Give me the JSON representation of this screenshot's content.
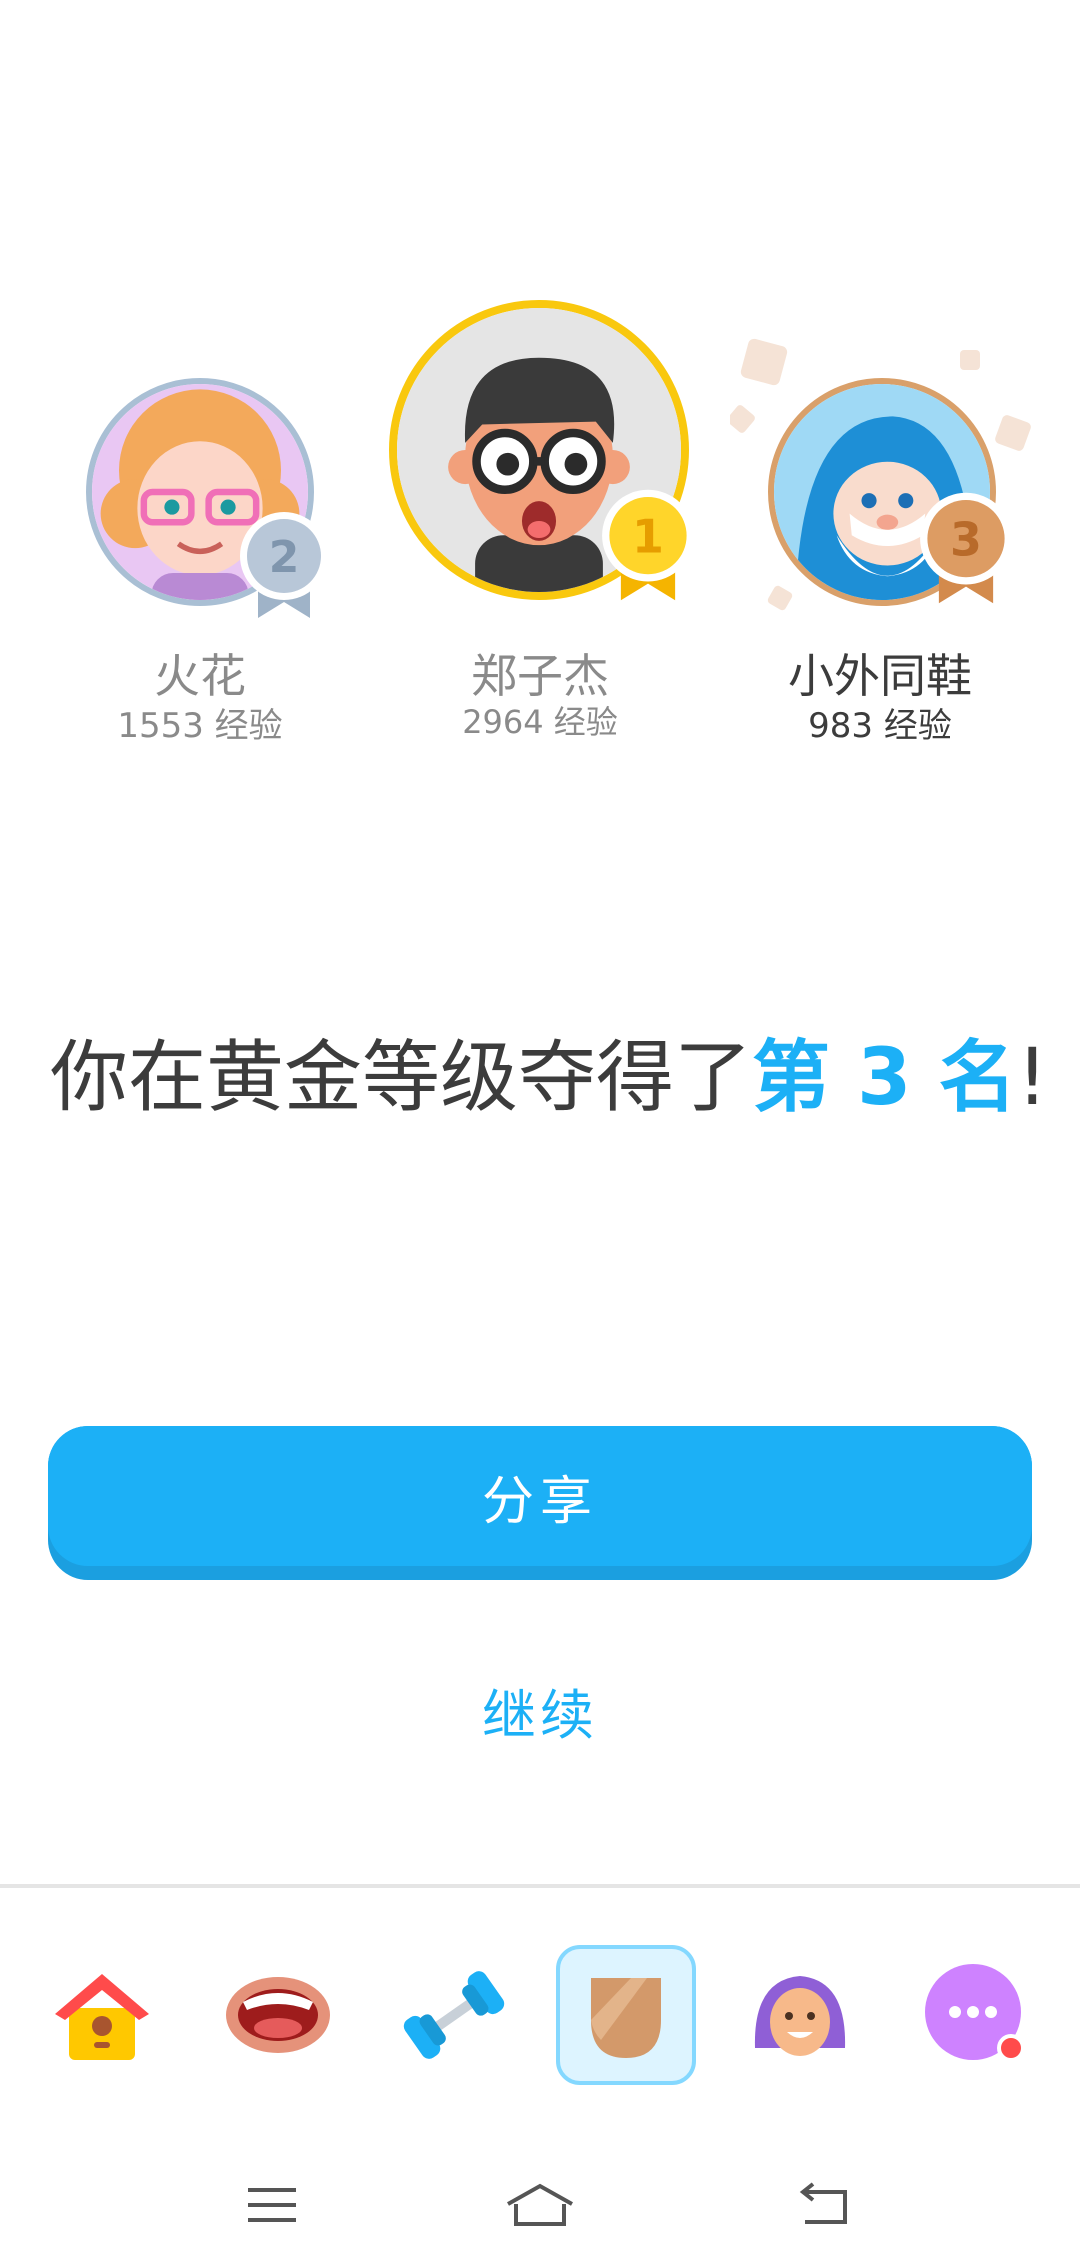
{
  "podium": [
    {
      "rank": "2",
      "name": "火花",
      "xp": "1553 经验",
      "ring_color": "#a9bfd4",
      "medal_color": "#b8c7d8",
      "medal_text_color": "#7f95ad",
      "name_color": "#8a8a8a"
    },
    {
      "rank": "1",
      "name": "郑子杰",
      "xp": "2964 经验",
      "ring_color": "#f9c80e",
      "medal_color": "#ffd52a",
      "medal_text_color": "#e69d00",
      "name_color": "#8a8a8a"
    },
    {
      "rank": "3",
      "name": "小外同鞋",
      "xp": "983 经验",
      "ring_color": "#d9a06a",
      "medal_color": "#dd9c63",
      "medal_text_color": "#b86a2a",
      "name_color": "#3c3c3c"
    }
  ],
  "headline": {
    "prefix": "你在黄金等级夺得了",
    "highlight": "第 3 名",
    "suffix": "!"
  },
  "actions": {
    "share_label": "分享",
    "continue_label": "继续"
  },
  "bottom_nav": [
    {
      "name": "home-tab",
      "icon": "home-icon",
      "active": false
    },
    {
      "name": "speak-tab",
      "icon": "mouth-icon",
      "active": false
    },
    {
      "name": "practice-tab",
      "icon": "dumbbell-icon",
      "active": false
    },
    {
      "name": "leagues-tab",
      "icon": "shield-icon",
      "active": true
    },
    {
      "name": "profile-tab",
      "icon": "avatar-icon",
      "active": false
    },
    {
      "name": "more-tab",
      "icon": "more-icon",
      "active": false
    }
  ],
  "colors": {
    "accent": "#1cb0f6",
    "text_dark": "#3c3c3c",
    "text_gray": "#8a8a8a"
  }
}
